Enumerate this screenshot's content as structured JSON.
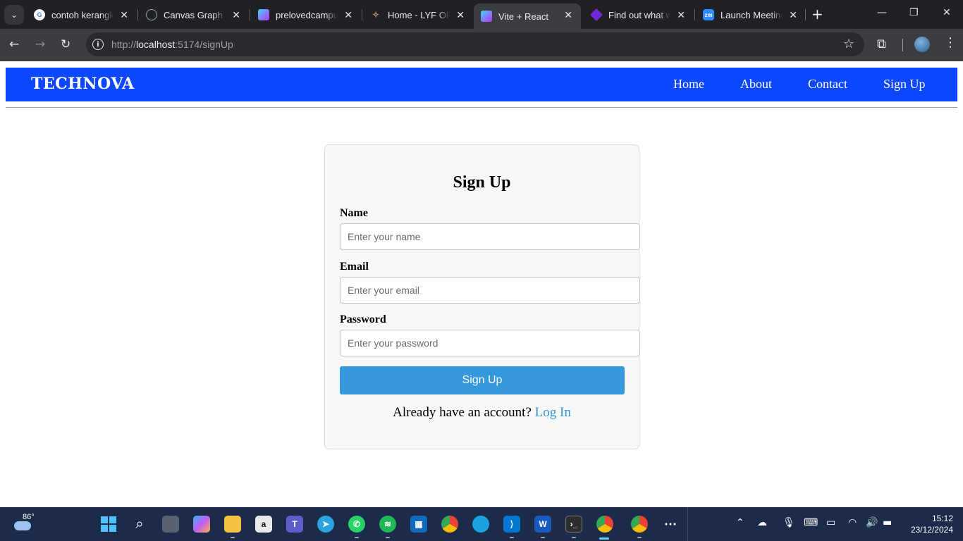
{
  "browser": {
    "tabs": [
      {
        "label": "contoh kerangka",
        "icon": "google-icon",
        "color": "#4285f4",
        "active": false
      },
      {
        "label": "Canvas Graph dan",
        "icon": "openai-icon",
        "color": "#9aa0a6",
        "active": false
      },
      {
        "label": "prelovedcampus",
        "icon": "vite-icon",
        "color": "#a855f7",
        "active": false
      },
      {
        "label": "Home - LYF OFFICIAL",
        "icon": "lyf-icon",
        "color": "#c8a26a",
        "active": false
      },
      {
        "label": "Vite + React",
        "icon": "vite-icon",
        "color": "#a855f7",
        "active": true
      },
      {
        "label": "Find out what we",
        "icon": "diamond-icon",
        "color": "#6d28d9",
        "active": false
      },
      {
        "label": "Launch Meeting",
        "icon": "zoom-icon",
        "color": "#2d8cff",
        "active": false
      }
    ],
    "url_scheme": "http://",
    "url_host": "localhost",
    "url_path": ":5174/signUp"
  },
  "site": {
    "brand": "TECHNOVA",
    "nav": {
      "home": "Home",
      "about": "About",
      "contact": "Contact",
      "signup": "Sign Up"
    },
    "colors": {
      "navbar": "#0d47ff",
      "button": "#3498db",
      "link": "#3498db"
    }
  },
  "form": {
    "title": "Sign Up",
    "name_label": "Name",
    "name_placeholder": "Enter your name",
    "email_label": "Email",
    "email_placeholder": "Enter your email",
    "password_label": "Password",
    "password_placeholder": "Enter your password",
    "submit_label": "Sign Up",
    "footer_text": "Already have an account?",
    "footer_link": "Log In"
  },
  "taskbar": {
    "weather_temp": "86°",
    "time": "15:12",
    "date": "23/12/2024"
  }
}
